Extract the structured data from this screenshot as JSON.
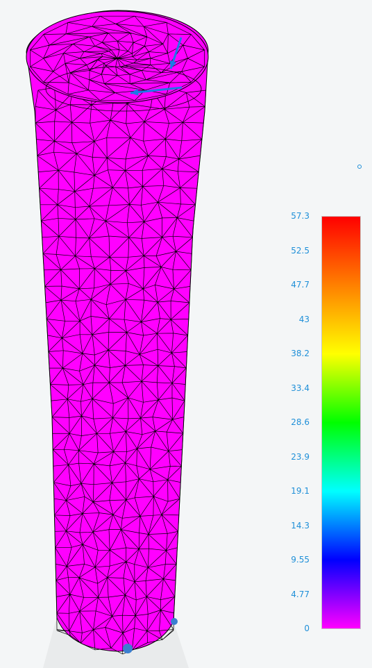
{
  "viewport": {
    "object": "tapered-cylinder-mesh",
    "mesh_color": "#ff00ff",
    "edge_color": "#000000",
    "arrow_color": "#1e78e6",
    "background": "#f4f6f7"
  },
  "legend": {
    "labels": [
      "57.3",
      "52.5",
      "47.7",
      "43",
      "38.2",
      "33.4",
      "28.6",
      "23.9",
      "19.1",
      "14.3",
      "9.55",
      "4.77",
      "0"
    ],
    "label_color": "#1e8fd8",
    "gradient_colors": [
      "#ff0000",
      "#ff8000",
      "#ffff00",
      "#00ff00",
      "#00ffff",
      "#0000ff",
      "#ff00ff"
    ]
  }
}
